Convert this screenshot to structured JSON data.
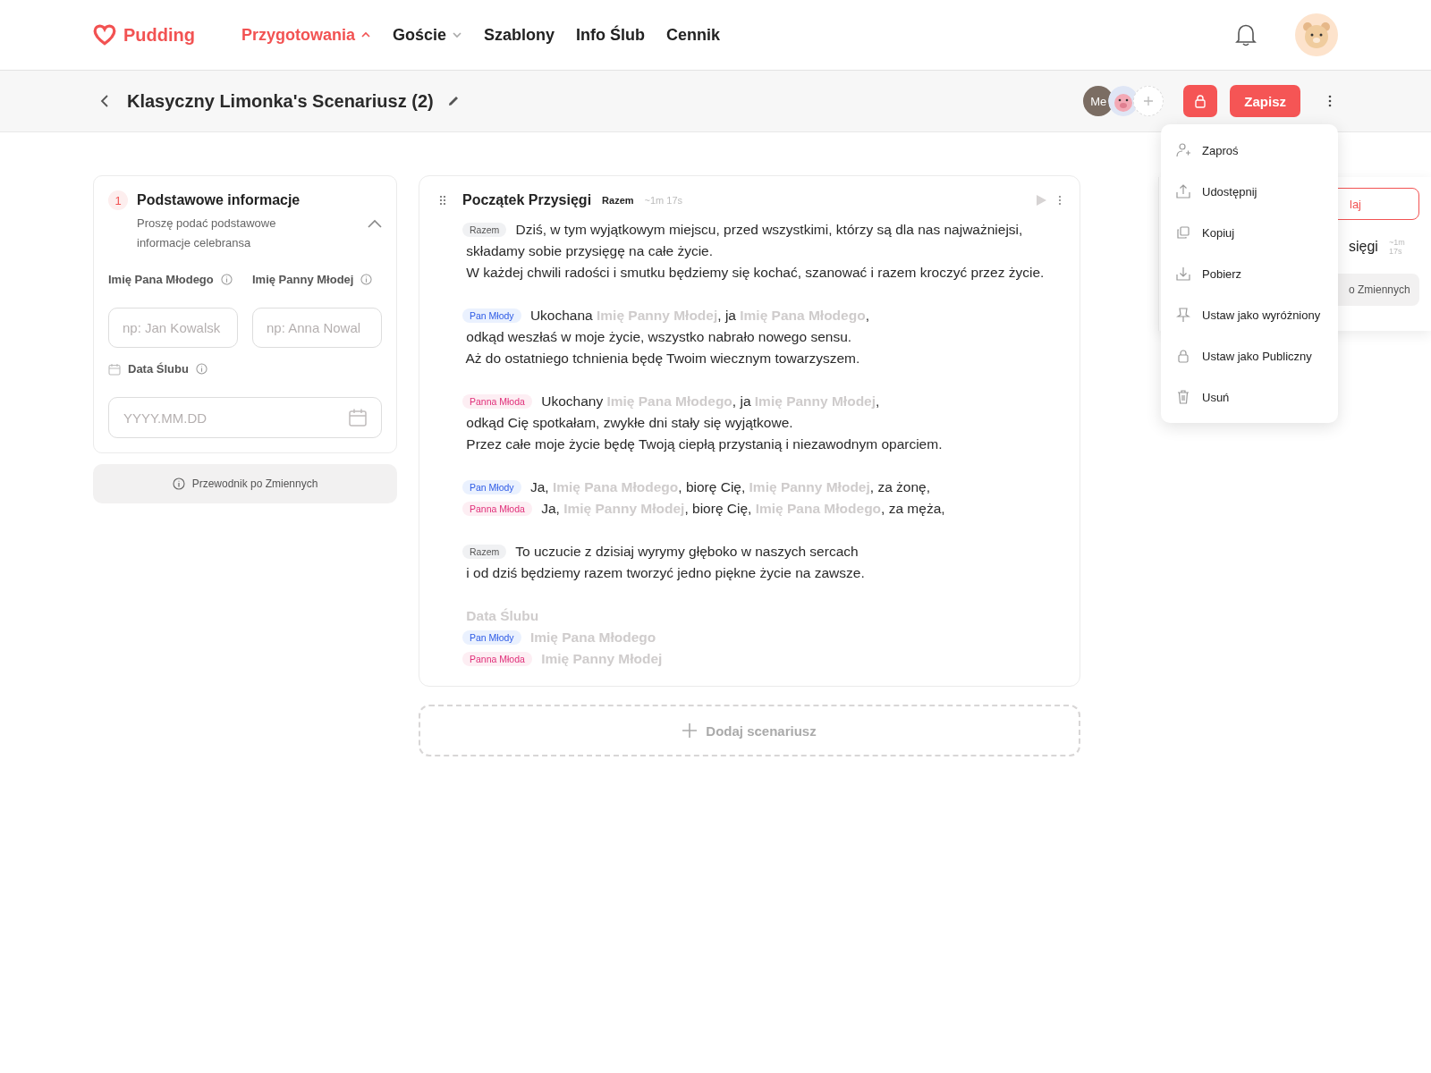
{
  "brand": {
    "name": "Pudding"
  },
  "nav": [
    {
      "label": "Przygotowania",
      "selected": true,
      "dropdown": true
    },
    {
      "label": "Goście",
      "selected": false,
      "dropdown": true
    },
    {
      "label": "Szablony",
      "selected": false,
      "dropdown": false
    },
    {
      "label": "Info Ślub",
      "selected": false,
      "dropdown": false
    },
    {
      "label": "Cennik",
      "selected": false,
      "dropdown": false
    }
  ],
  "toolbar": {
    "title": "Klasyczny Limonka's Scenariusz (2)",
    "collaborators": [
      {
        "label": "Me",
        "kind": "initials"
      },
      {
        "kind": "avatar"
      }
    ],
    "save_label": "Zapisz",
    "locked": true
  },
  "info_section": {
    "number": "1",
    "title": "Podstawowe informacje",
    "subtitle": "Proszę podać podstawowe informacje celebransa",
    "expanded": true,
    "fields": [
      {
        "label": "Imię Pana Młodego",
        "placeholder": "np: Jan Kowalsk"
      },
      {
        "label": "Imię Panny Młodej",
        "placeholder": "np: Anna Nowal"
      }
    ],
    "date_field": {
      "label": "Data Ślubu",
      "placeholder": "YYYY.MM.DD"
    },
    "guide_button": "Przewodnik po Zmiennych"
  },
  "script_card": {
    "title": "Początek Przysięgi",
    "speaker": "Razem",
    "duration": "~1m 17s",
    "blocks": [
      {
        "lines": [
          {
            "speaker": {
              "label": "Razem",
              "kind": "together"
            },
            "segments": [
              {
                "kind": "text",
                "text": "Dziś, w tym wyjątkowym miejscu, przed wszystkimi, którzy są dla nas najważniejsi,"
              }
            ]
          },
          {
            "segments": [
              {
                "kind": "text",
                "text": "składamy sobie przysięgę na całe życie."
              }
            ]
          },
          {
            "segments": [
              {
                "kind": "text",
                "text": "W każdej chwili radości i smutku będziemy się kochać, szanować i razem kroczyć przez życie."
              }
            ]
          }
        ]
      },
      {
        "lines": [
          {
            "speaker": {
              "label": "Pan Młody",
              "kind": "groom"
            },
            "segments": [
              {
                "kind": "text",
                "text": "Ukochana "
              },
              {
                "kind": "variable",
                "text": "Imię Panny Młodej"
              },
              {
                "kind": "text",
                "text": ", ja "
              },
              {
                "kind": "variable",
                "text": "Imię Pana Młodego"
              },
              {
                "kind": "text",
                "text": ","
              }
            ]
          },
          {
            "segments": [
              {
                "kind": "text",
                "text": "odkąd weszłaś w moje życie, wszystko nabrało nowego sensu."
              }
            ]
          },
          {
            "segments": [
              {
                "kind": "text",
                "text": "Aż do ostatniego tchnienia będę Twoim wiecznym towarzyszem."
              }
            ]
          }
        ]
      },
      {
        "lines": [
          {
            "speaker": {
              "label": "Panna Młoda",
              "kind": "bride"
            },
            "segments": [
              {
                "kind": "text",
                "text": "Ukochany "
              },
              {
                "kind": "variable",
                "text": "Imię Pana Młodego"
              },
              {
                "kind": "text",
                "text": ", ja "
              },
              {
                "kind": "variable",
                "text": "Imię Panny Młodej"
              },
              {
                "kind": "text",
                "text": ","
              }
            ]
          },
          {
            "segments": [
              {
                "kind": "text",
                "text": "odkąd Cię spotkałam, zwykłe dni stały się wyjątkowe."
              }
            ]
          },
          {
            "segments": [
              {
                "kind": "text",
                "text": "Przez całe moje życie będę Twoją ciepłą przystanią i niezawodnym oparciem."
              }
            ]
          }
        ]
      },
      {
        "lines": [
          {
            "speaker": {
              "label": "Pan Młody",
              "kind": "groom"
            },
            "segments": [
              {
                "kind": "text",
                "text": "Ja, "
              },
              {
                "kind": "variable",
                "text": "Imię Pana Młodego"
              },
              {
                "kind": "text",
                "text": ", biorę Cię, "
              },
              {
                "kind": "variable",
                "text": "Imię Panny Młodej"
              },
              {
                "kind": "text",
                "text": ", za żonę,"
              }
            ]
          },
          {
            "speaker": {
              "label": "Panna Młoda",
              "kind": "bride"
            },
            "segments": [
              {
                "kind": "text",
                "text": "Ja, "
              },
              {
                "kind": "variable",
                "text": "Imię Panny Młodej"
              },
              {
                "kind": "text",
                "text": ", biorę Cię, "
              },
              {
                "kind": "variable",
                "text": "Imię Pana Młodego"
              },
              {
                "kind": "text",
                "text": ", za męża,"
              }
            ]
          }
        ]
      },
      {
        "lines": [
          {
            "speaker": {
              "label": "Razem",
              "kind": "together"
            },
            "segments": [
              {
                "kind": "text",
                "text": "To uczucie z dzisiaj wyrymy głęboko w naszych sercach"
              }
            ]
          },
          {
            "segments": [
              {
                "kind": "text",
                "text": "i od dziś będziemy razem tworzyć jedno piękne życie na zawsze."
              }
            ]
          }
        ]
      },
      {
        "lines": [
          {
            "segments": [
              {
                "kind": "variable",
                "text": "Data Ślubu"
              }
            ]
          },
          {
            "speaker": {
              "label": "Pan Młody",
              "kind": "groom"
            },
            "segments": [
              {
                "kind": "variable",
                "text": "Imię Pana Młodego"
              }
            ]
          },
          {
            "speaker": {
              "label": "Panna Młoda",
              "kind": "bride"
            },
            "segments": [
              {
                "kind": "variable",
                "text": "Imię Panny Młodej"
              }
            ]
          }
        ]
      }
    ]
  },
  "add_button": "Dodaj scenariusz",
  "back_panel": {
    "button_fragment": "laj",
    "title_fragment": "sięgi",
    "duration": "~1m 17s",
    "guide_fragment": "o Zmiennych"
  },
  "menu": [
    {
      "label": "Zaproś",
      "kind": "invite"
    },
    {
      "label": "Udostępnij",
      "kind": "share"
    },
    {
      "label": "Kopiuj",
      "kind": "copy"
    },
    {
      "label": "Pobierz",
      "kind": "download"
    },
    {
      "label": "Ustaw jako wyróżniony",
      "kind": "pin"
    },
    {
      "label": "Ustaw jako Publiczny",
      "kind": "lock"
    },
    {
      "label": "Usuń",
      "kind": "delete"
    }
  ]
}
